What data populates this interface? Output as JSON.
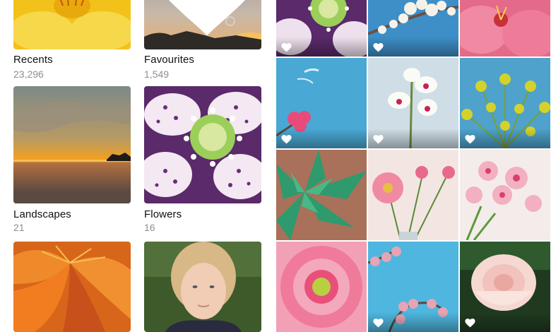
{
  "albums": [
    {
      "title": "Recents",
      "count": "23,296",
      "favourite_marked": false,
      "thumb": "yellow-flower"
    },
    {
      "title": "Favourites",
      "count": "1,549",
      "favourite_marked": true,
      "thumb": "sunset-bubbles"
    },
    {
      "title": "Landscapes",
      "count": "21",
      "favourite_marked": false,
      "thumb": "sea-sunset"
    },
    {
      "title": "Flowers",
      "count": "16",
      "favourite_marked": false,
      "thumb": "purple-flower"
    },
    {
      "title": "",
      "count": "",
      "favourite_marked": false,
      "thumb": "orange-lily"
    },
    {
      "title": "",
      "count": "",
      "favourite_marked": false,
      "thumb": "portrait"
    }
  ],
  "grid_photos": [
    {
      "subject": "purple-white flower",
      "favourite": true
    },
    {
      "subject": "white blossoms on blue sky",
      "favourite": true
    },
    {
      "subject": "pink hibiscus",
      "favourite": false
    },
    {
      "subject": "pink flower on blue sky",
      "favourite": true
    },
    {
      "subject": "white orchid",
      "favourite": true
    },
    {
      "subject": "yellow euphorbia",
      "favourite": true
    },
    {
      "subject": "green succulent",
      "favourite": false
    },
    {
      "subject": "pink gerbera in vase",
      "favourite": false
    },
    {
      "subject": "pink blossoms",
      "favourite": false
    },
    {
      "subject": "pink gerbera",
      "favourite": false
    },
    {
      "subject": "cherry blossoms on blue sky",
      "favourite": true
    },
    {
      "subject": "pink peony",
      "favourite": true
    }
  ],
  "icons": {
    "favourite": "heart-icon"
  },
  "colors": {
    "title": "#111111",
    "count": "#8e8e93",
    "heart": "#ffffff"
  }
}
